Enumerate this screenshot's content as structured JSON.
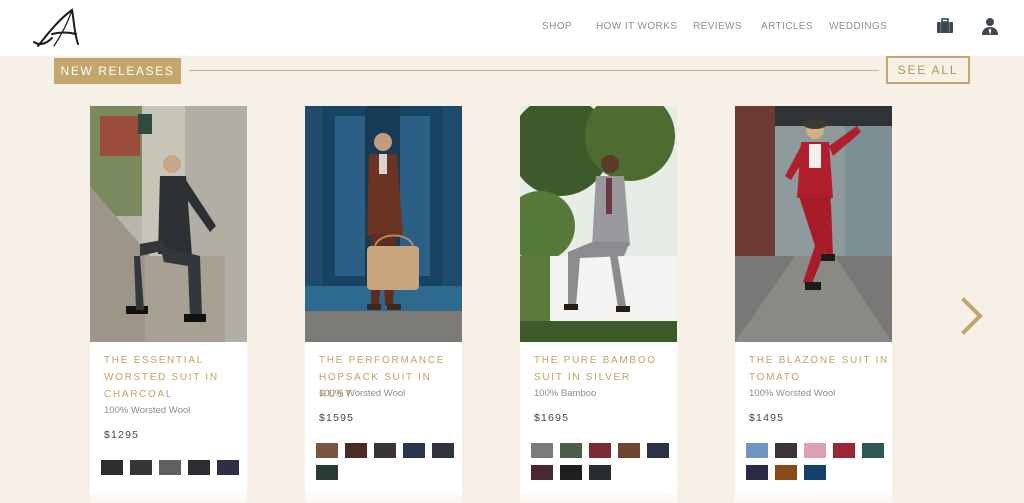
{
  "header": {
    "logo_icon": "script-a-logo-icon",
    "nav": [
      "SHOP",
      "HOW IT WORKS",
      "REVIEWS",
      "ARTICLES",
      "WEDDINGS"
    ],
    "bag_icon": "briefcase-icon",
    "account_icon": "user-icon"
  },
  "section": {
    "badge": "NEW RELEASES",
    "see_all": "SEE ALL",
    "next_icon": "chevron-right-icon"
  },
  "colors": {
    "gold": "#c4a56b",
    "cream": "#f6f0e6",
    "nav": "#8a8f99"
  },
  "products": [
    {
      "title": "THE ESSENTIAL WORSTED SUIT IN CHARCOAL",
      "fabric": "100% Worsted Wool",
      "price": "$1295",
      "swatches": [
        "#2e2e30",
        "#34373a",
        "#5f5f60",
        "#2b2d31",
        "#2b3045"
      ]
    },
    {
      "title": "THE PERFORMANCE HOPSACK SUIT IN RUST",
      "fabric": "100% Worsted Wool",
      "price": "$1595",
      "swatches": [
        "#7a5540",
        "#4a2b25",
        "#3a3432",
        "#2a3550",
        "#2f333b",
        "#2a3a34"
      ]
    },
    {
      "title": "THE PURE BAMBOO SUIT IN SILVER",
      "fabric": "100% Bamboo",
      "price": "$1695",
      "swatches": [
        "#7a7a7c",
        "#4b5f48",
        "#7a2a35",
        "#6e4535",
        "#2b3447",
        "#4a2630",
        "#1f1f22",
        "#2a2c33"
      ]
    },
    {
      "title": "THE BLAZONE SUIT IN TOMATO",
      "fabric": "100% Worsted Wool",
      "price": "$1495",
      "swatches": [
        "#6f94c2",
        "#3e3433",
        "#dda0b7",
        "#9b2636",
        "#2f5855",
        "#2b2a45",
        "#8a4a1e",
        "#15406e"
      ]
    }
  ]
}
